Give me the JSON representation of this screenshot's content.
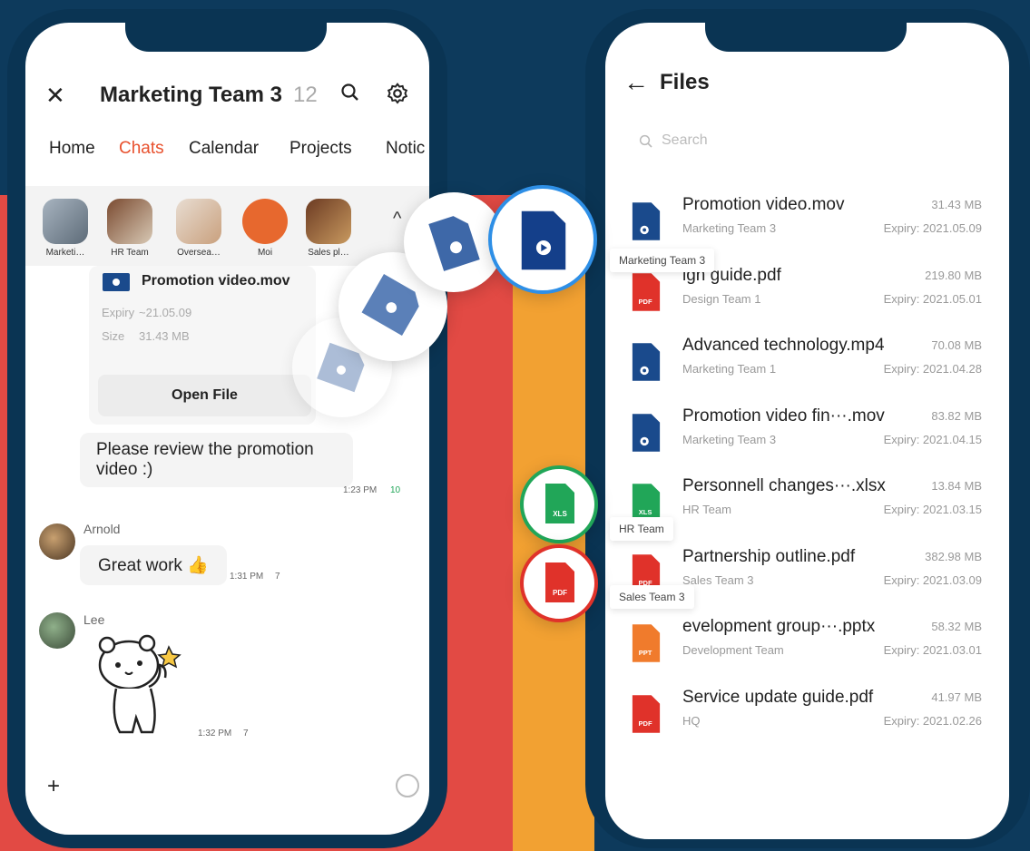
{
  "chat": {
    "title": "Marketing Team 3",
    "member_count": "12",
    "tabs": [
      "Home",
      "Chats",
      "Calendar",
      "Projects",
      "Notic"
    ],
    "members": [
      "Marketi…",
      "HR Team",
      "Oversea…",
      "Moi",
      "Sales pl…"
    ],
    "file_card": {
      "name": "Promotion video.mov",
      "expiry_label": "Expiry",
      "expiry_value": "~21.05.09",
      "size_label": "Size",
      "size_value": "31.43 MB",
      "open_label": "Open File"
    },
    "messages": [
      {
        "text": "Please review the promotion video :)",
        "time": "1:23 PM",
        "read": "10"
      },
      {
        "sender": "Arnold",
        "text": "Great work 👍",
        "time": "1:31 PM",
        "read": "7"
      },
      {
        "sender": "Lee",
        "time": "1:32 PM",
        "read": "7"
      }
    ]
  },
  "files": {
    "title": "Files",
    "search_placeholder": "Search",
    "items": [
      {
        "name": "Promotion video.mov",
        "team": "Marketing Team 3",
        "size": "31.43 MB",
        "expiry": "Expiry: 2021.05.09",
        "type": "video"
      },
      {
        "name": "ign guide.pdf",
        "team": "Design Team 1",
        "size": "219.80 MB",
        "expiry": "Expiry: 2021.05.01",
        "type": "pdf"
      },
      {
        "name": "Advanced technology.mp4",
        "team": "Marketing Team 1",
        "size": "70.08 MB",
        "expiry": "Expiry: 2021.04.28",
        "type": "video"
      },
      {
        "name": "Promotion video fin···.mov",
        "team": "Marketing Team 3",
        "size": "83.82 MB",
        "expiry": "Expiry: 2021.04.15",
        "type": "video"
      },
      {
        "name": "Personnell changes···.xlsx",
        "team": "HR Team",
        "size": "13.84 MB",
        "expiry": "Expiry: 2021.03.15",
        "type": "xls"
      },
      {
        "name": "Partnership outline.pdf",
        "team": "Sales Team 3",
        "size": "382.98 MB",
        "expiry": "Expiry: 2021.03.09",
        "type": "pdf"
      },
      {
        "name": "evelopment group···.pptx",
        "team": "Development Team",
        "size": "58.32 MB",
        "expiry": "Expiry: 2021.03.01",
        "type": "ppt"
      },
      {
        "name": "Service update guide.pdf",
        "team": "HQ",
        "size": "41.97 MB",
        "expiry": "Expiry: 2021.02.26",
        "type": "pdf"
      }
    ],
    "icon_labels": {
      "pdf": "PDF",
      "xls": "XLS",
      "ppt": "PPT"
    }
  },
  "tags": {
    "marketing": "Marketing Team 3",
    "hr": "HR Team",
    "sales": "Sales Team 3"
  },
  "colors": {
    "accent": "#e8502d",
    "video": "#1a4a8c",
    "pdf": "#e0322a",
    "xls": "#21a658",
    "ppt": "#f07b2c"
  }
}
